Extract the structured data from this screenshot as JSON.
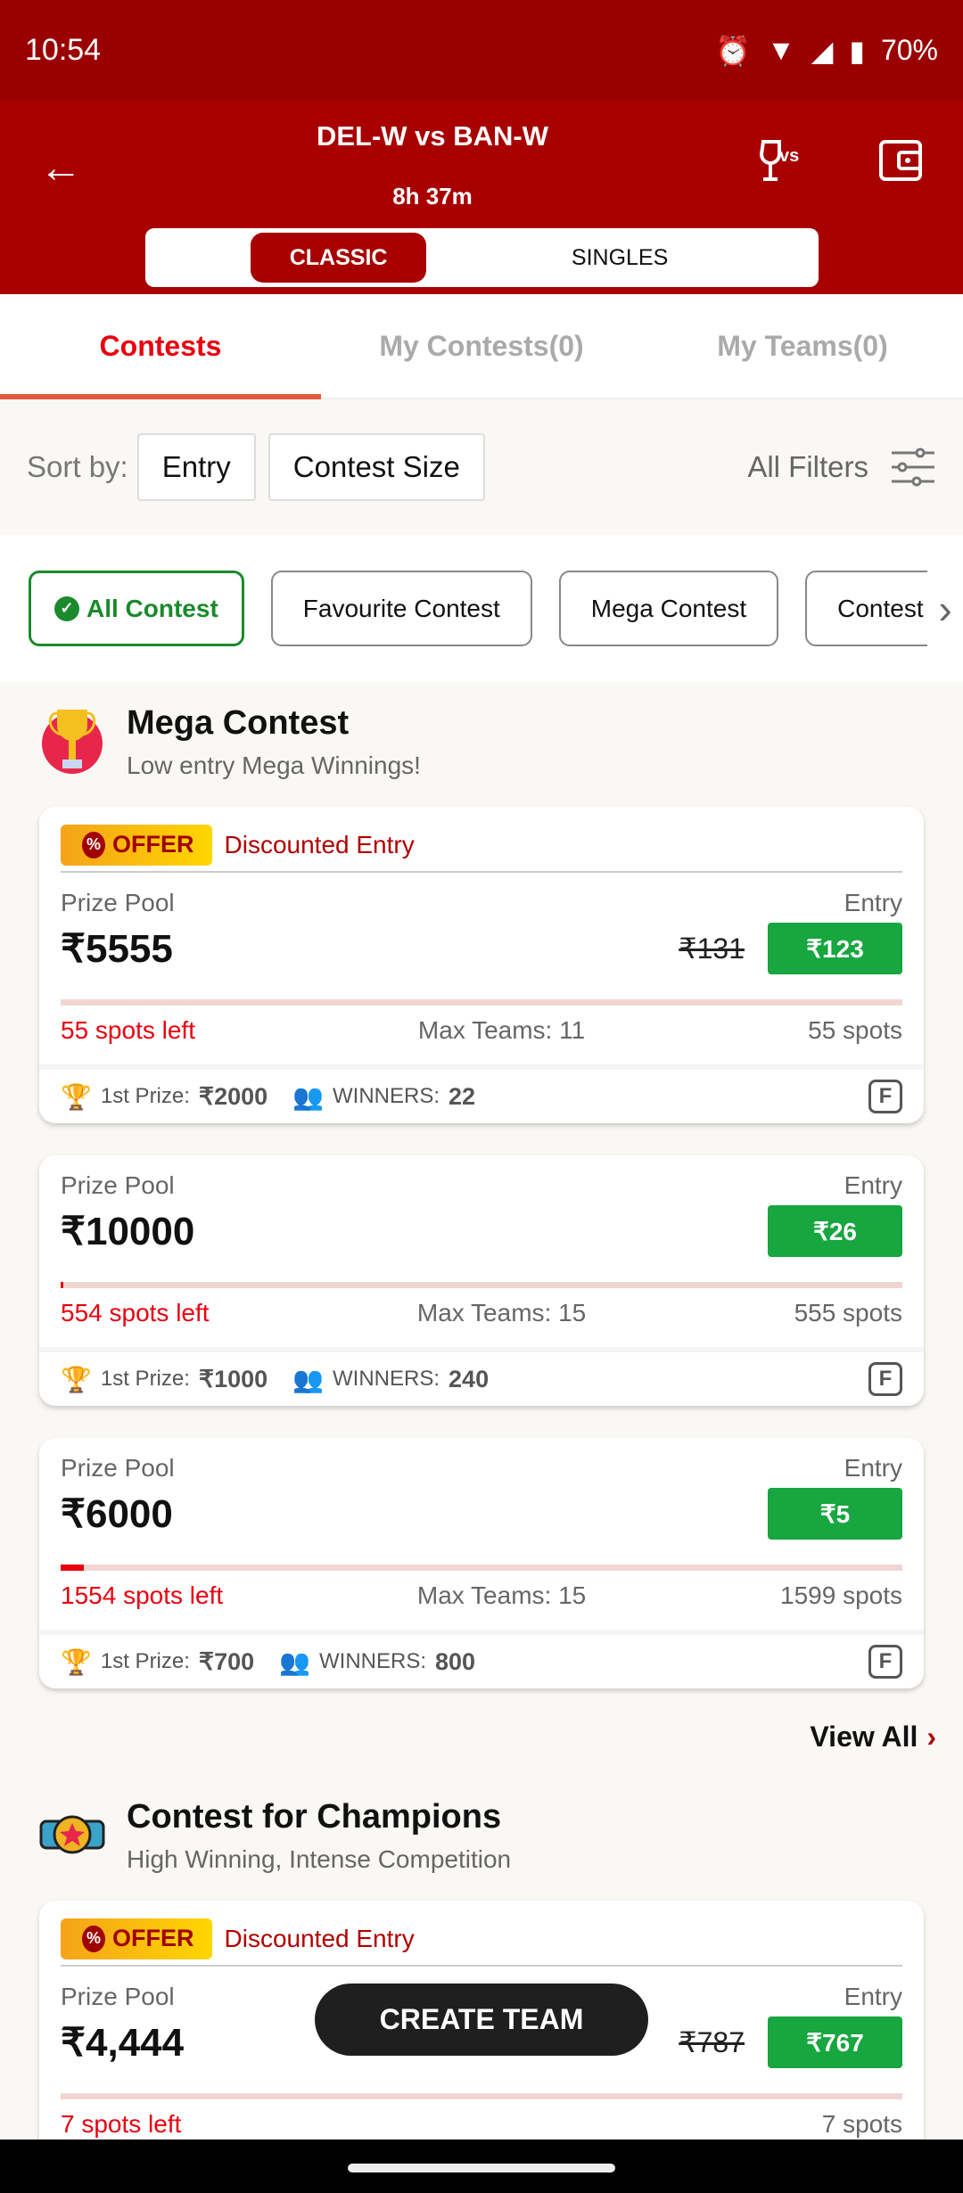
{
  "status": {
    "time": "10:54",
    "battery": "70%"
  },
  "header": {
    "title": "DEL-W vs BAN-W",
    "timer": "8h 37m",
    "modes": [
      "CLASSIC",
      "SINGLES"
    ]
  },
  "tabs": [
    "Contests",
    "My Contests(0)",
    "My Teams(0)"
  ],
  "sort": {
    "label": "Sort by:",
    "options": [
      "Entry",
      "Contest Size"
    ],
    "filters": "All Filters"
  },
  "chips": [
    "All Contest",
    "Favourite Contest",
    "Mega Contest",
    "Contest"
  ],
  "colors": {
    "brand": "#a80000",
    "accent": "#e8000f",
    "entry": "#17a63f"
  },
  "sections": [
    {
      "title": "Mega Contest",
      "subtitle": "Low entry Mega Winnings!",
      "icon": "trophy-icon",
      "view_all": "View All",
      "cards": [
        {
          "offer": "OFFER",
          "offer_text": "Discounted Entry",
          "prize_label": "Prize Pool",
          "prize": "₹5555",
          "entry_label": "Entry",
          "old_entry": "₹131",
          "entry": "₹123",
          "filled_pct": 0,
          "spots_left": "55 spots left",
          "max_teams": "Max Teams: 11",
          "spots": "55 spots",
          "first_prize_label": "1st Prize:",
          "first_prize": "₹2000",
          "winners_label": "WINNERS:",
          "winners": "22",
          "badge": "F"
        },
        {
          "prize_label": "Prize Pool",
          "prize": "₹10000",
          "entry_label": "Entry",
          "entry": "₹26",
          "filled_pct": 0.2,
          "spots_left": "554 spots left",
          "max_teams": "Max Teams: 15",
          "spots": "555 spots",
          "first_prize_label": "1st Prize:",
          "first_prize": "₹1000",
          "winners_label": "WINNERS:",
          "winners": "240",
          "badge": "F"
        },
        {
          "prize_label": "Prize Pool",
          "prize": "₹6000",
          "entry_label": "Entry",
          "entry": "₹5",
          "filled_pct": 2.8,
          "spots_left": "1554 spots left",
          "max_teams": "Max Teams: 15",
          "spots": "1599 spots",
          "first_prize_label": "1st Prize:",
          "first_prize": "₹700",
          "winners_label": "WINNERS:",
          "winners": "800",
          "badge": "F"
        }
      ]
    },
    {
      "title": "Contest for Champions",
      "subtitle": "High Winning, Intense Competition",
      "icon": "championship-belt-icon",
      "cards": [
        {
          "offer": "OFFER",
          "offer_text": "Discounted Entry",
          "prize_label": "Prize Pool",
          "prize": "₹4,444",
          "entry_label": "Entry",
          "old_entry": "₹787",
          "entry": "₹767",
          "filled_pct": 0,
          "spots_left": "7 spots left",
          "spots": "7 spots"
        }
      ]
    }
  ],
  "create_team": "CREATE TEAM"
}
